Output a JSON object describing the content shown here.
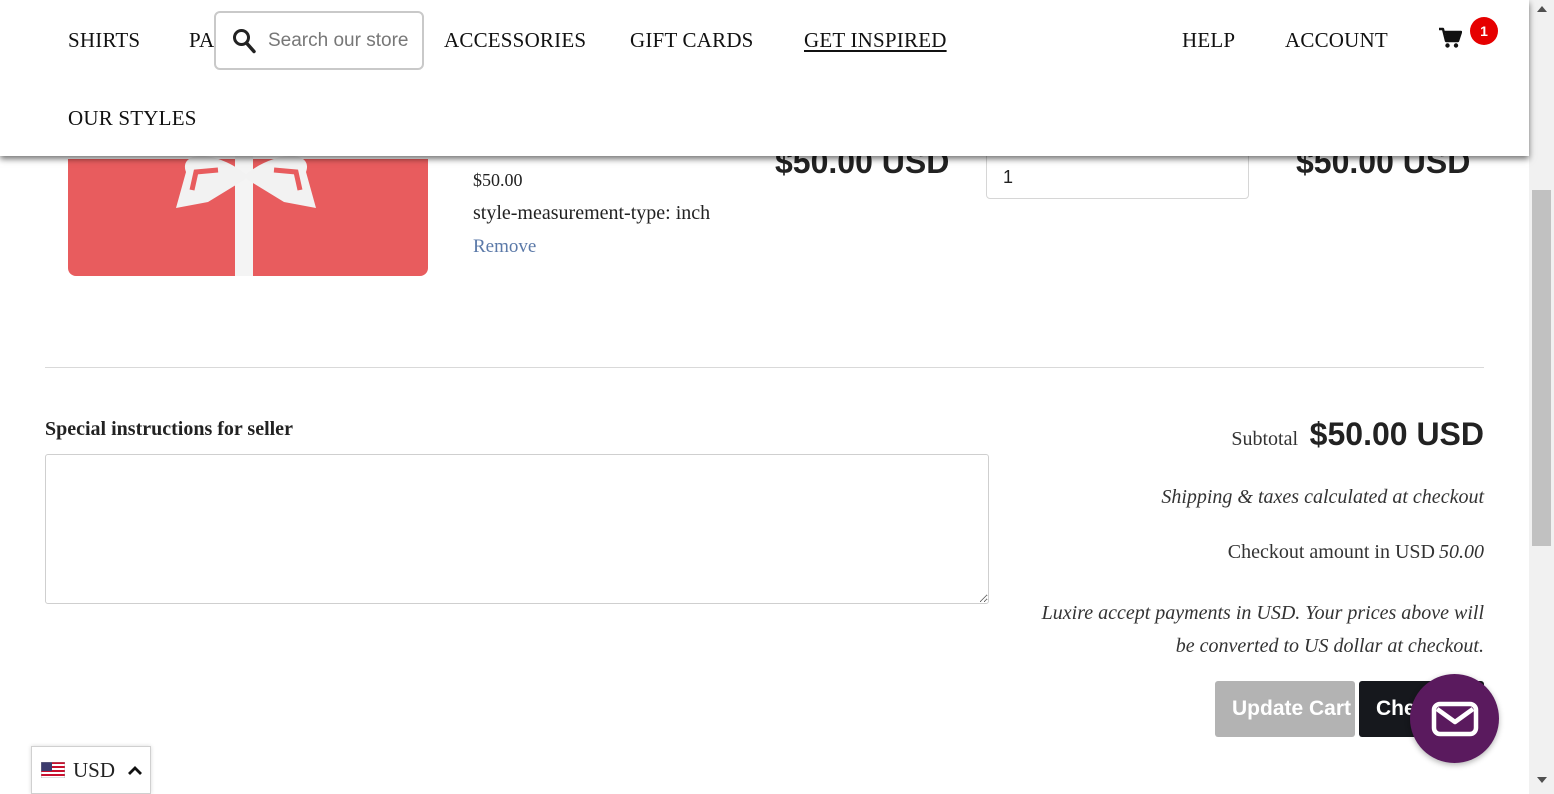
{
  "header": {
    "nav_row1": [
      "SHIRTS",
      "PA",
      "ACCESSORIES",
      "GIFT CARDS",
      "GET INSPIRED"
    ],
    "nav_right": [
      "HELP",
      "ACCOUNT"
    ],
    "nav_row2": [
      "OUR STYLES"
    ],
    "search": {
      "placeholder": "Search our store"
    },
    "cart": {
      "count": "1",
      "icon": "cart-icon"
    }
  },
  "cart_item": {
    "variant_price": "$50.00",
    "property": "style-measurement-type: inch",
    "remove_label": "Remove",
    "price": "$50.00 USD",
    "quantity": "1",
    "line_total": "$50.00 USD"
  },
  "notes": {
    "label": "Special instructions for seller",
    "value": ""
  },
  "summary": {
    "subtotal_label": "Subtotal",
    "subtotal_value": "$50.00 USD",
    "shipping_note": "Shipping & taxes calculated at checkout",
    "checkout_amount_label": "Checkout amount in USD",
    "checkout_amount_value": "50.00",
    "payment_note_line1": "Luxire accept payments in USD. Your prices above will",
    "payment_note_line2": "be converted to US dollar at checkout."
  },
  "buttons": {
    "update_cart": "Update Cart",
    "checkout": "Checkout"
  },
  "currency_selector": {
    "code": "USD",
    "flag": "us-flag-icon"
  },
  "colors": {
    "accent_badge": "#e60000",
    "gift_card": "#e85c5e",
    "chat": "#5a1a5e",
    "checkout_button": "#16181d",
    "update_button": "#b3b3b3",
    "link": "#5b79a8"
  }
}
